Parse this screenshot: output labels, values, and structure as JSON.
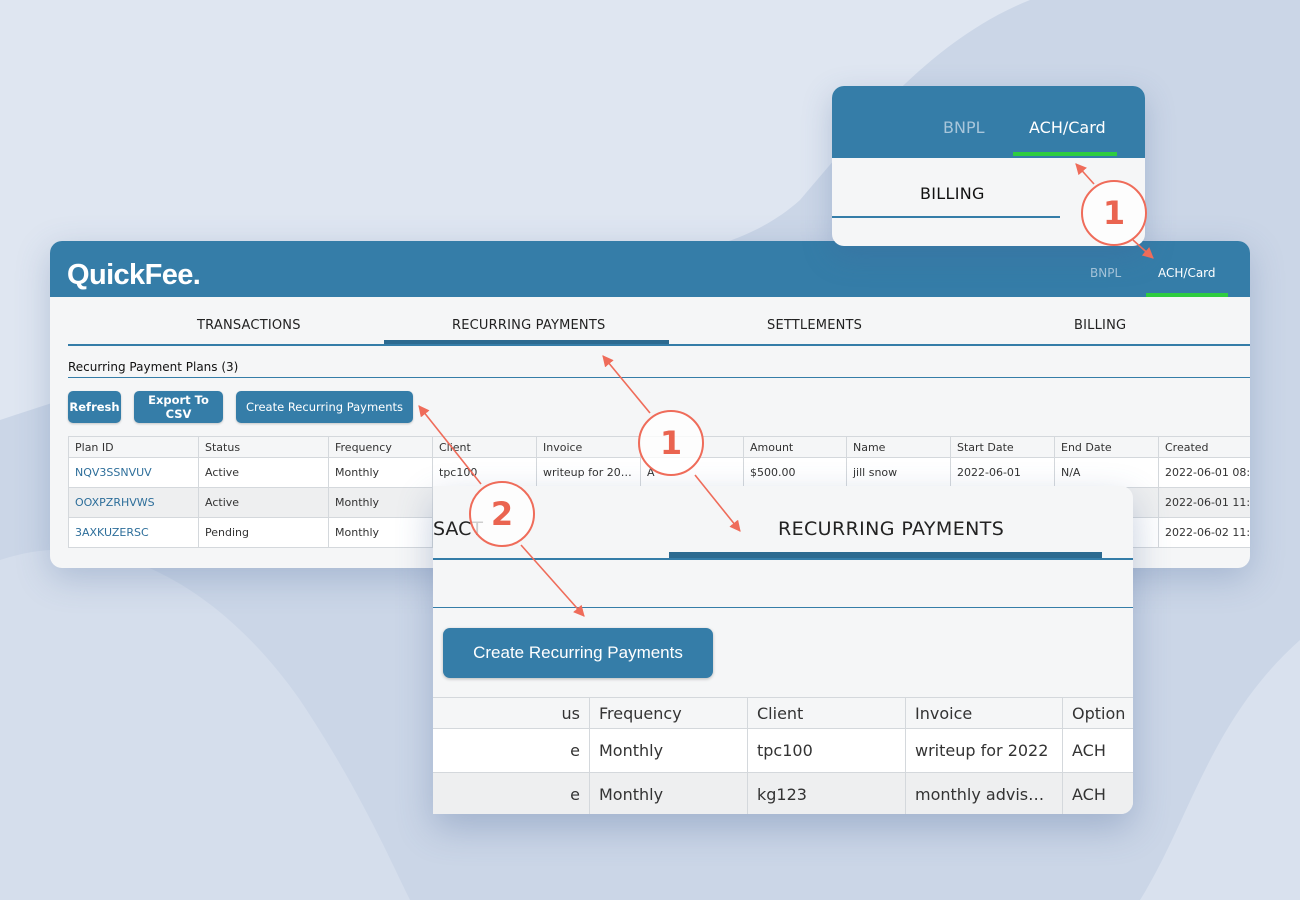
{
  "header": {
    "logo": "QuickFee.",
    "tabs": [
      "BNPL",
      "ACH/Card"
    ],
    "active_tab": "ACH/Card"
  },
  "nav": {
    "tabs": [
      "TRANSACTIONS",
      "RECURRING PAYMENTS",
      "SETTLEMENTS",
      "BILLING"
    ],
    "active": "RECURRING PAYMENTS"
  },
  "section_title": "Recurring Payment Plans (3)",
  "toolbar": {
    "refresh": "Refresh",
    "export": "Export To CSV",
    "create": "Create Recurring Payments"
  },
  "table": {
    "columns": [
      "Plan ID",
      "Status",
      "Frequency",
      "Client",
      "Invoice",
      "",
      "Amount",
      "Name",
      "Start Date",
      "End Date",
      "Created"
    ],
    "rows": [
      [
        "NQV3SSNVUV",
        "Active",
        "Monthly",
        "tpc100",
        "writeup for 2022",
        "A",
        "$500.00",
        "jill snow",
        "2022-06-01",
        "N/A",
        "2022-06-01 08:..."
      ],
      [
        "OOXPZRHVWS",
        "Active",
        "Monthly",
        "",
        "",
        "",
        "",
        "",
        "",
        "",
        "2022-06-01 11:..."
      ],
      [
        "3AXKUZERSC",
        "Pending",
        "Monthly",
        "",
        "",
        "",
        "",
        "",
        "",
        "",
        "2022-06-02 11:..."
      ]
    ]
  },
  "zoom_header": {
    "tabs": [
      "BNPL",
      "ACH/Card"
    ],
    "billing": "BILLING"
  },
  "zoom_detail": {
    "left_tab_fragment": "SACT",
    "active_tab": "RECURRING PAYMENTS",
    "button": "Create Recurring Payments",
    "columns": [
      "us",
      "Frequency",
      "Client",
      "Invoice",
      "Option"
    ],
    "rows": [
      [
        "e",
        "Monthly",
        "tpc100",
        "writeup for 2022",
        "ACH"
      ],
      [
        "e",
        "Monthly",
        "kg123",
        "monthly advisory services",
        "ACH"
      ]
    ]
  },
  "callouts": [
    "1",
    "1",
    "2"
  ],
  "colors": {
    "brand": "#357da8",
    "active_underline": "#2ecc40",
    "callout": "#ef6c5a",
    "background": "#ccd7e8"
  }
}
